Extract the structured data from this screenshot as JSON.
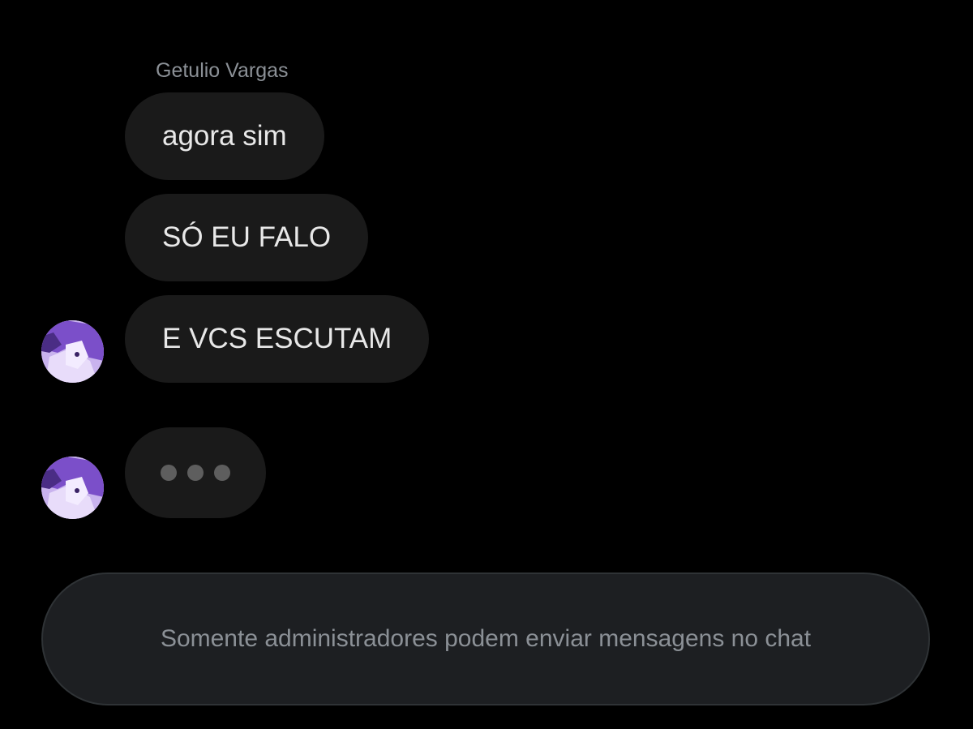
{
  "chat": {
    "sender_name": "Getulio Vargas",
    "messages": [
      {
        "text": "agora sim"
      },
      {
        "text": "SÓ EU FALO"
      },
      {
        "text": "E VCS ESCUTAM"
      }
    ],
    "typing_indicator": {
      "dots": 3
    },
    "avatar_icon": "user-avatar-anime-purple"
  },
  "composer": {
    "notice": "Somente administradores podem enviar mensagens no chat"
  },
  "colors": {
    "background": "#000000",
    "bubble": "#1a1a1a",
    "bubble_text": "#e8e8e8",
    "muted_text": "#8b9096",
    "composer_bg": "#1d1f22",
    "composer_border": "#2f3336",
    "avatar_accent": "#9b6fd8"
  }
}
